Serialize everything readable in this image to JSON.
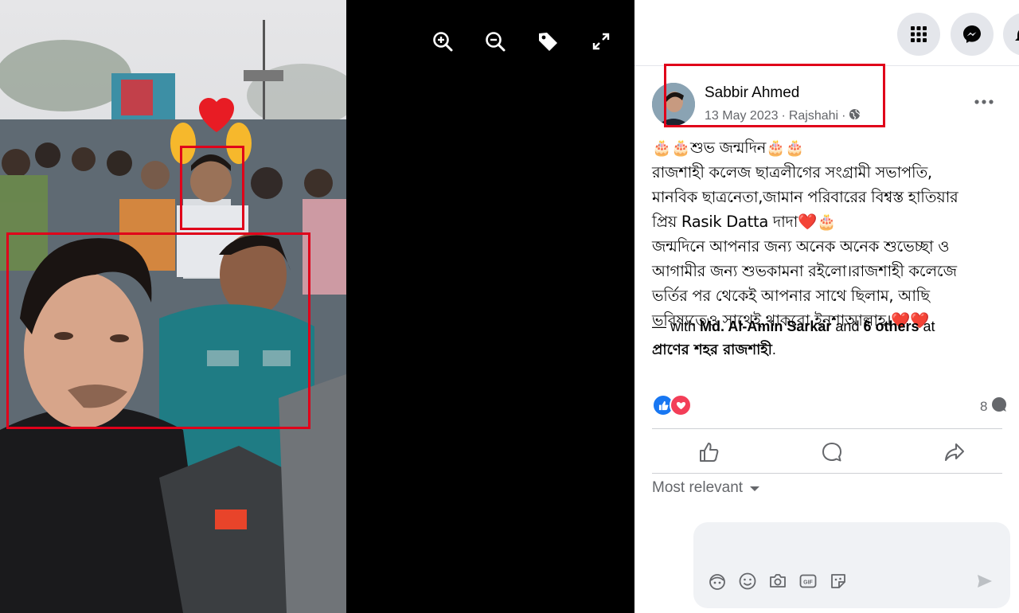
{
  "viewer": {
    "tools": [
      "zoom-in-icon",
      "zoom-out-icon",
      "tag-icon",
      "fullscreen-icon"
    ]
  },
  "topbar": {
    "icons": [
      "menu-grid-icon",
      "messenger-icon",
      "notifications-icon"
    ]
  },
  "post": {
    "author": "Sabbir Ahmed",
    "date": "13 May 2023",
    "separator": "·",
    "location": "Rajshahi",
    "privacy_icon": "globe-icon",
    "text_lines": [
      "🎂🎂শুভ জন্মদিন🎂🎂",
      "রাজশাহী কলেজ ছাত্রলীগের সংগ্রামী সভাপতি,",
      "মানবিক ছাত্রনেতা,জামান পরিবারের বিশ্বস্ত হাতিয়ার",
      "প্রিয় Rasik Datta দাদা❤️🎂",
      "জন্মদিনে আপনার জন্য অনেক অনেক শুভেচ্ছা ও",
      "আগামীর জন্য শুভকামনা রইলো।রাজশাহী কলেজে",
      "ভর্তির পর থেকেই আপনার সাথে ছিলাম, আছি",
      "ভবিষ্যতেও সাথেই থাকবো ইনশাআল্লাহ।❤️❤️"
    ],
    "with_prefix": "— with",
    "with_name": "Md. Al-Amin Sarkar",
    "with_and": "and",
    "with_others": "6 others",
    "with_at": "at",
    "place": "প্রাণের শহর রাজশাহী",
    "place_suffix": "."
  },
  "reactions": {
    "types": [
      "like",
      "love"
    ],
    "comment_count": "8"
  },
  "actions": [
    "like-button",
    "comment-button",
    "share-button"
  ],
  "comments": {
    "sort_label": "Most relevant",
    "input_placeholder": ""
  },
  "colors": {
    "accent": "#1877f2",
    "love": "#f33e58",
    "annotation": "#e0001a"
  }
}
